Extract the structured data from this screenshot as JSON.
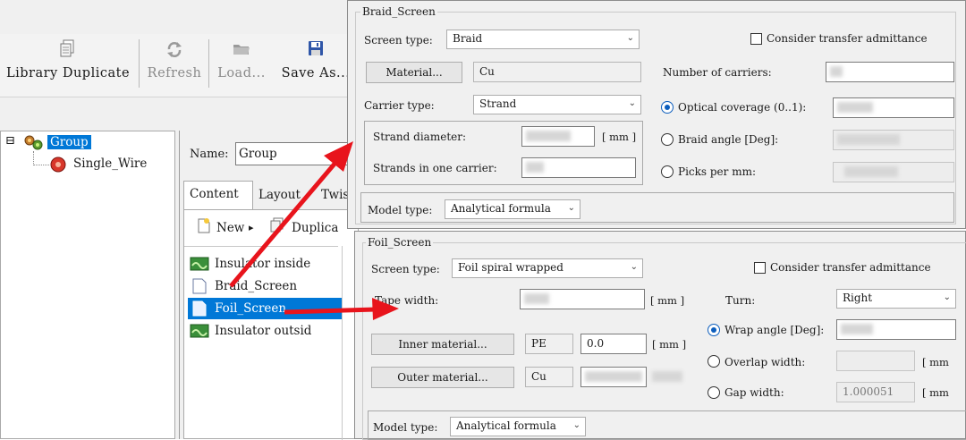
{
  "toolbar": {
    "library_duplicate": "Library Duplicate",
    "refresh": "Refresh",
    "load": "Load...",
    "save_as": "Save As..."
  },
  "tree": {
    "expander": "⊟",
    "root": "Group",
    "child": "Single_Wire"
  },
  "detail": {
    "name_label": "Name:",
    "name_value": "Group",
    "tabs": [
      "Content",
      "Layout",
      "Twis"
    ],
    "new_label": "New",
    "duplicate_label": "Duplica",
    "items": [
      "Insulator inside",
      "Braid_Screen",
      "Foil_Screen",
      "Insulator outsid"
    ]
  },
  "braid": {
    "title": "Braid_Screen",
    "screen_type_label": "Screen type:",
    "screen_type_value": "Braid",
    "transfer_label": "Consider transfer admittance",
    "material_button": "Material...",
    "material_value": "Cu",
    "carriers_label": "Number of carriers:",
    "carrier_type_label": "Carrier type:",
    "carrier_type_value": "Strand",
    "optical_label": "Optical coverage (0..1):",
    "strand_diameter_label": "Strand diameter:",
    "strand_unit": "[ mm ]",
    "braid_angle_label": "Braid angle [Deg]:",
    "strands_label": "Strands in one carrier:",
    "picks_label": "Picks per mm:",
    "model_type_label": "Model type:",
    "model_type_value": "Analytical formula"
  },
  "foil": {
    "title": "Foil_Screen",
    "screen_type_label": "Screen type:",
    "screen_type_value": "Foil spiral wrapped",
    "transfer_label": "Consider transfer admittance",
    "tape_width_label": "Tape width:",
    "tape_unit": "[ mm ]",
    "turn_label": "Turn:",
    "turn_value": "Right",
    "wrap_angle_label": "Wrap angle [Deg]:",
    "inner_button": "Inner material...",
    "inner_value": "PE",
    "inner_thickness": "0.0",
    "inner_unit": "[ mm ]",
    "overlap_label": "Overlap width:",
    "overlap_unit": "[ mm",
    "outer_button": "Outer material...",
    "outer_value": "Cu",
    "gap_label": "Gap width:",
    "gap_value": "1.000051",
    "gap_unit": "[ mm",
    "model_type_label": "Model type:",
    "model_type_value": "Analytical formula"
  },
  "colors": {
    "selection": "#0078d7",
    "arrow": "#e8141c",
    "radio_on": "#0d5ebd"
  }
}
